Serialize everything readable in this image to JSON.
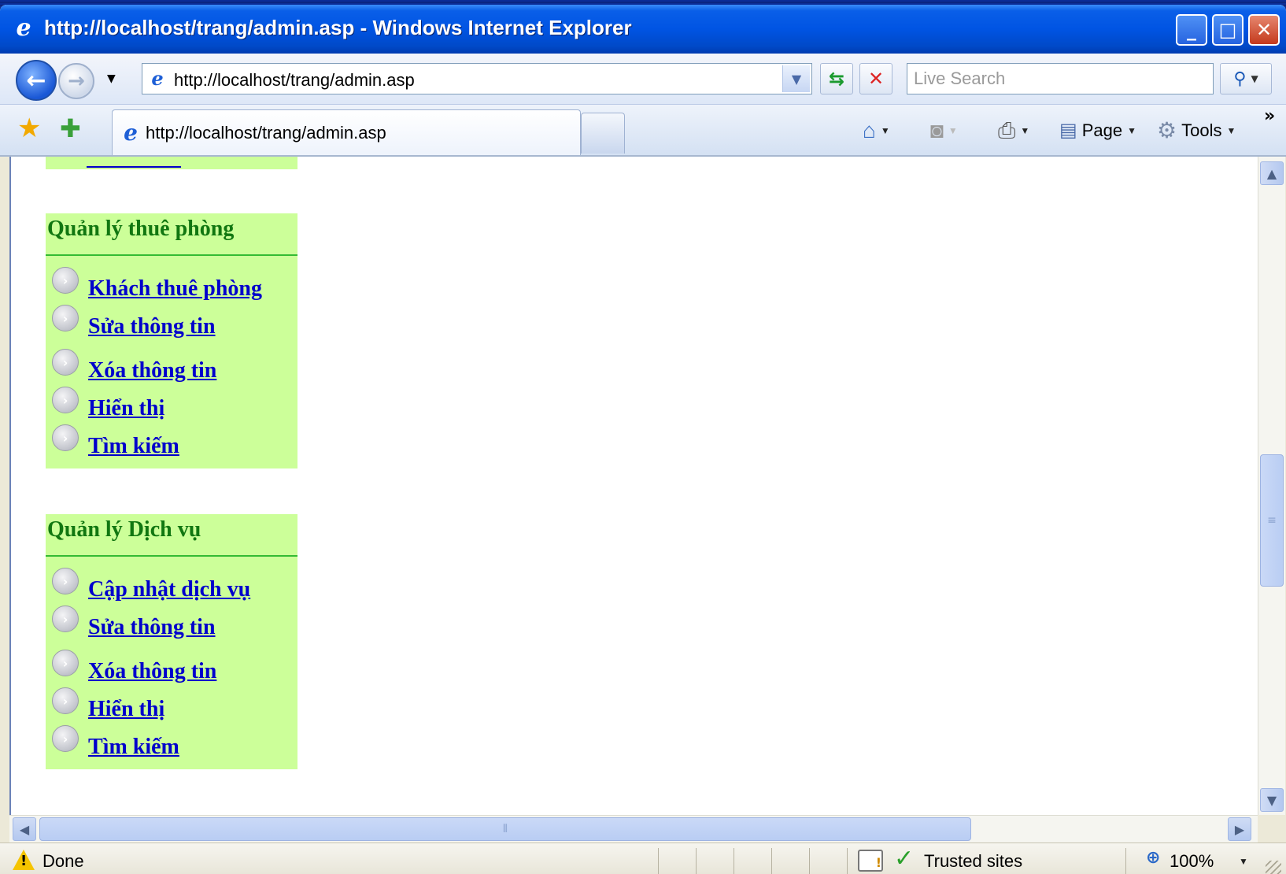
{
  "window": {
    "title": "http://localhost/trang/admin.asp - Windows Internet Explorer",
    "minimize": "_",
    "maximize": "□",
    "close": "✕"
  },
  "nav": {
    "back_icon": "back-arrow-icon",
    "forward_icon": "forward-arrow-icon",
    "address": "http://localhost/trang/admin.asp",
    "search_placeholder": "Live Search"
  },
  "tabs": [
    {
      "label": "http://localhost/trang/admin.asp"
    }
  ],
  "commands": {
    "page": "Page",
    "tools": "Tools"
  },
  "sections": [
    {
      "title": "Quản lý thuê phòng",
      "items": [
        "Khách thuê phòng",
        "Sửa thông tin",
        "Xóa thông tin",
        "Hiển thị",
        "Tìm kiếm"
      ]
    },
    {
      "title": "Quản lý Dịch vụ",
      "items": [
        "Cập nhật dịch vụ",
        "Sửa thông tin",
        "Xóa thông tin",
        "Hiển thị",
        "Tìm kiếm"
      ]
    }
  ],
  "status": {
    "text": "Done",
    "zone": "Trusted sites",
    "zoom": "100%"
  },
  "colors": {
    "panel_bg": "#ccff99",
    "section_title": "#117711",
    "link": "#0000cc"
  }
}
